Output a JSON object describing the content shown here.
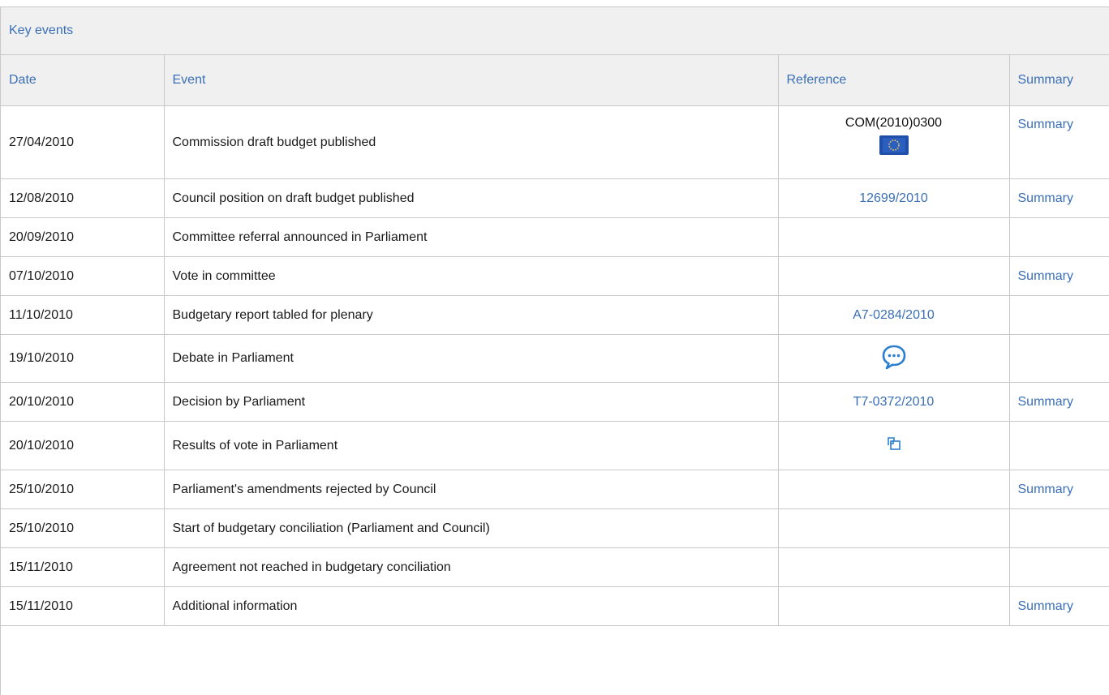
{
  "panel": {
    "title": "Key events"
  },
  "columns": {
    "date": "Date",
    "event": "Event",
    "reference": "Reference",
    "summary": "Summary"
  },
  "rows": [
    {
      "date": "27/04/2010",
      "event": "Commission draft budget published",
      "reference_text": "COM(2010)0300",
      "reference_icon": "eu-flag-icon",
      "summary": "Summary"
    },
    {
      "date": "12/08/2010",
      "event": "Council position on draft budget published",
      "reference_link": "12699/2010",
      "summary": "Summary"
    },
    {
      "date": "20/09/2010",
      "event": "Committee referral announced in Parliament"
    },
    {
      "date": "07/10/2010",
      "event": "Vote in committee",
      "summary": "Summary"
    },
    {
      "date": "11/10/2010",
      "event": "Budgetary report tabled for plenary",
      "reference_link": "A7-0284/2010"
    },
    {
      "date": "19/10/2010",
      "event": "Debate in Parliament",
      "reference_icon": "debate-speech-bubble-icon"
    },
    {
      "date": "20/10/2010",
      "event": "Decision by Parliament",
      "reference_link": "T7-0372/2010",
      "summary": "Summary"
    },
    {
      "date": "20/10/2010",
      "event": "Results of vote in Parliament",
      "reference_icon": "vote-results-icon"
    },
    {
      "date": "25/10/2010",
      "event": "Parliament's amendments rejected by Council",
      "summary": "Summary"
    },
    {
      "date": "25/10/2010",
      "event": "Start of budgetary conciliation (Parliament and Council)"
    },
    {
      "date": "15/11/2010",
      "event": "Agreement not reached in budgetary conciliation"
    },
    {
      "date": "15/11/2010",
      "event": "Additional information",
      "summary": "Summary"
    }
  ],
  "colors": {
    "link": "#3a6fb5",
    "header_bg": "#f0f0f0",
    "border": "#c8c8c8",
    "eu_blue": "#1f4fa8",
    "eu_gold": "#f2c94c"
  }
}
